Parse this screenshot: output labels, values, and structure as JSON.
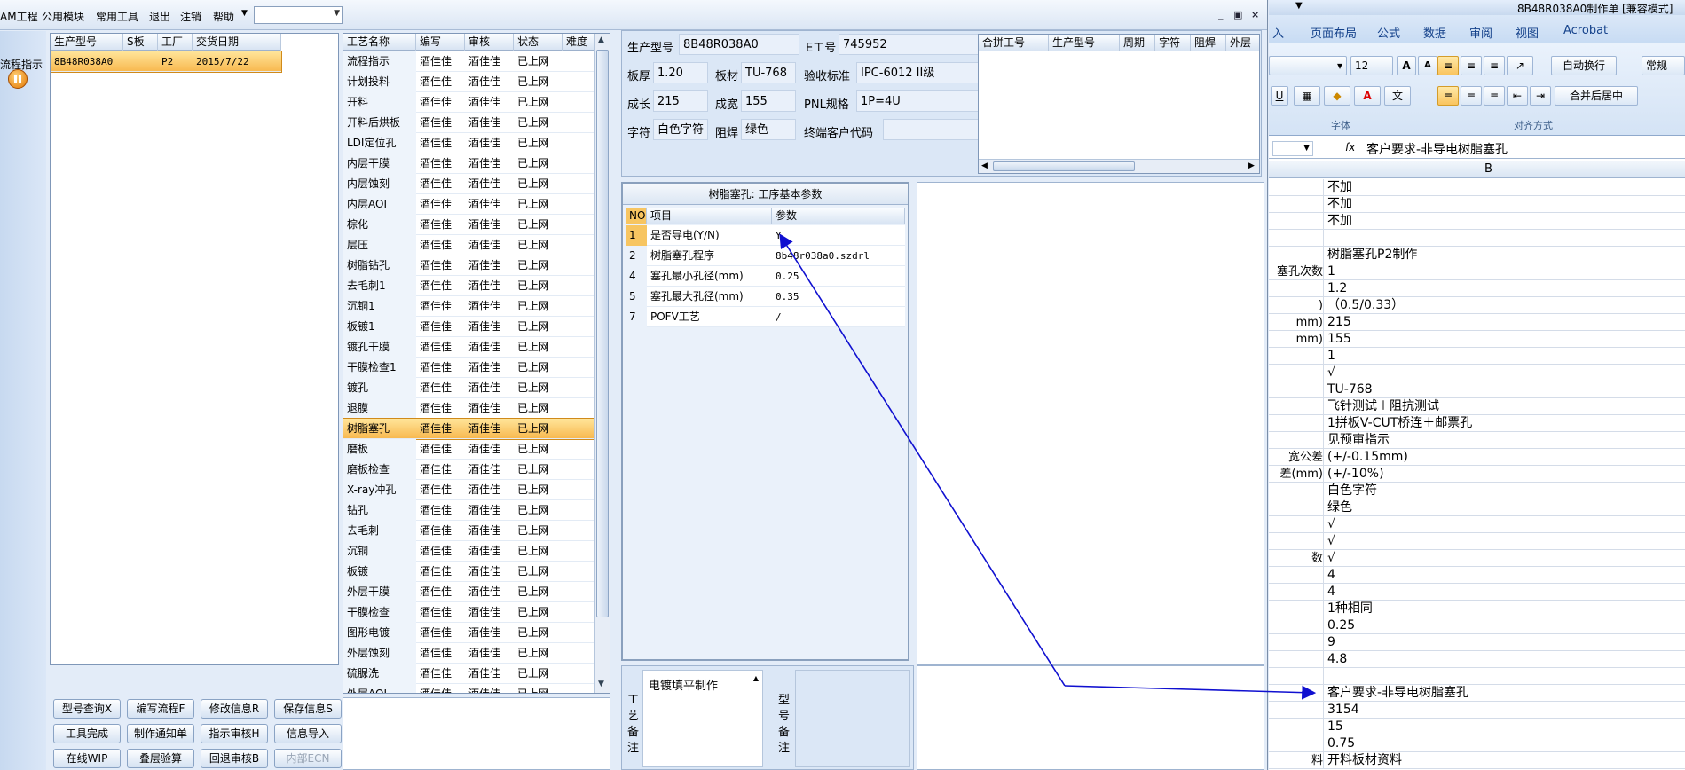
{
  "menu": {
    "items": [
      "AM工程",
      "公用模块",
      "常用工具",
      "退出",
      "注销",
      "帮助"
    ],
    "window_controls": [
      "_",
      "▣",
      "×"
    ]
  },
  "left_nav": {
    "label": "流程指示"
  },
  "model_grid": {
    "headers": [
      "生产型号",
      "S板",
      "工厂",
      "交货日期"
    ],
    "rows": [
      [
        "8B48R038A0",
        "",
        "P2",
        "2015/7/22"
      ]
    ]
  },
  "process_grid": {
    "headers": [
      "工艺名称",
      "编写",
      "审核",
      "状态",
      "难度"
    ],
    "rows": [
      [
        "流程指示",
        "酒佳佳",
        "酒佳佳",
        "已上网"
      ],
      [
        "计划投料",
        "酒佳佳",
        "酒佳佳",
        "已上网"
      ],
      [
        "开料",
        "酒佳佳",
        "酒佳佳",
        "已上网"
      ],
      [
        "开料后烘板",
        "酒佳佳",
        "酒佳佳",
        "已上网"
      ],
      [
        "LDI定位孔",
        "酒佳佳",
        "酒佳佳",
        "已上网"
      ],
      [
        "内层干膜",
        "酒佳佳",
        "酒佳佳",
        "已上网"
      ],
      [
        "内层蚀刻",
        "酒佳佳",
        "酒佳佳",
        "已上网"
      ],
      [
        "内层AOI",
        "酒佳佳",
        "酒佳佳",
        "已上网"
      ],
      [
        "棕化",
        "酒佳佳",
        "酒佳佳",
        "已上网"
      ],
      [
        "层压",
        "酒佳佳",
        "酒佳佳",
        "已上网"
      ],
      [
        "树脂钻孔",
        "酒佳佳",
        "酒佳佳",
        "已上网"
      ],
      [
        "去毛刺1",
        "酒佳佳",
        "酒佳佳",
        "已上网"
      ],
      [
        "沉铜1",
        "酒佳佳",
        "酒佳佳",
        "已上网"
      ],
      [
        "板镀1",
        "酒佳佳",
        "酒佳佳",
        "已上网"
      ],
      [
        "镀孔干膜",
        "酒佳佳",
        "酒佳佳",
        "已上网"
      ],
      [
        "干膜检查1",
        "酒佳佳",
        "酒佳佳",
        "已上网"
      ],
      [
        "镀孔",
        "酒佳佳",
        "酒佳佳",
        "已上网"
      ],
      [
        "退膜",
        "酒佳佳",
        "酒佳佳",
        "已上网"
      ],
      [
        "树脂塞孔",
        "酒佳佳",
        "酒佳佳",
        "已上网"
      ],
      [
        "磨板",
        "酒佳佳",
        "酒佳佳",
        "已上网"
      ],
      [
        "磨板检查",
        "酒佳佳",
        "酒佳佳",
        "已上网"
      ],
      [
        "X-ray冲孔",
        "酒佳佳",
        "酒佳佳",
        "已上网"
      ],
      [
        "钻孔",
        "酒佳佳",
        "酒佳佳",
        "已上网"
      ],
      [
        "去毛刺",
        "酒佳佳",
        "酒佳佳",
        "已上网"
      ],
      [
        "沉铜",
        "酒佳佳",
        "酒佳佳",
        "已上网"
      ],
      [
        "板镀",
        "酒佳佳",
        "酒佳佳",
        "已上网"
      ],
      [
        "外层干膜",
        "酒佳佳",
        "酒佳佳",
        "已上网"
      ],
      [
        "干膜检查",
        "酒佳佳",
        "酒佳佳",
        "已上网"
      ],
      [
        "图形电镀",
        "酒佳佳",
        "酒佳佳",
        "已上网"
      ],
      [
        "外层蚀刻",
        "酒佳佳",
        "酒佳佳",
        "已上网"
      ],
      [
        "硫脲洗",
        "酒佳佳",
        "酒佳佳",
        "已上网"
      ],
      [
        "外层AOI",
        "酒佳佳",
        "酒佳佳",
        "已上网"
      ]
    ],
    "selected_index": 18
  },
  "buttons": [
    [
      "型号查询X",
      "编写流程F",
      "修改信息R",
      "保存信息S"
    ],
    [
      "工具完成",
      "制作通知单",
      "指示审核H",
      "信息导入"
    ],
    [
      "在线WIP",
      "叠层验算",
      "回退审核B",
      "内部ECN"
    ]
  ],
  "info": {
    "model_label": "生产型号",
    "model": "8B48R038A0",
    "e_label": "E工号",
    "e_no": "745952",
    "thick_label": "板厚",
    "thick": "1.20",
    "material_label": "板材",
    "material": "TU-768",
    "std_label": "验收标准",
    "std": "IPC-6012 II级",
    "len_label": "成长",
    "len": "215",
    "wid_label": "成宽",
    "wid": "155",
    "pnl_label": "PNL规格",
    "pnl": "1P=4U",
    "char_label": "字符",
    "char": "白色字符",
    "mask_label": "阻焊",
    "mask": "绿色",
    "cust_label": "终端客户代码",
    "cust": ""
  },
  "merge_grid": {
    "headers": [
      "合拼工号",
      "生产型号",
      "周期",
      "字符",
      "阻焊",
      "外层"
    ]
  },
  "params": {
    "title": "树脂塞孔: 工序基本参数",
    "headers": [
      "NO",
      "项目",
      "参数"
    ],
    "rows": [
      [
        "1",
        "是否导电(Y/N)",
        "Y"
      ],
      [
        "2",
        "树脂塞孔程序",
        "8b48r038a0.szdrl"
      ],
      [
        "4",
        "塞孔最小孔径(mm)",
        "0.25"
      ],
      [
        "5",
        "塞孔最大孔径(mm)",
        "0.35"
      ],
      [
        "7",
        "POFV工艺",
        "/"
      ]
    ]
  },
  "remark": {
    "label_left": "工艺备注",
    "text": "电镀填平制作",
    "label_right": "型号备注"
  },
  "excel": {
    "title": "8B48R038A0制作单 [兼容模式]",
    "tabs": [
      "入",
      "页面布局",
      "公式",
      "数据",
      "审阅",
      "视图",
      "Acrobat"
    ],
    "font_size": "12",
    "wrap_label": "自动换行",
    "normal_label": "常规",
    "merge_label": "合并后居中",
    "group_font": "字体",
    "group_align": "对齐方式",
    "formula": "客户要求-非导电树脂塞孔",
    "fx": "fx",
    "column_b": "B",
    "rows": [
      [
        "",
        "不加"
      ],
      [
        "",
        "不加"
      ],
      [
        "",
        "不加"
      ],
      [
        "",
        ""
      ],
      [
        "",
        "树脂塞孔P2制作"
      ],
      [
        "塞孔次数",
        "1"
      ],
      [
        "",
        "1.2"
      ],
      [
        ")",
        "（0.5/0.33）"
      ],
      [
        "mm)",
        "215"
      ],
      [
        "mm)",
        "155"
      ],
      [
        "",
        "1"
      ],
      [
        "",
        "√"
      ],
      [
        "",
        "TU-768"
      ],
      [
        "",
        "飞针测试＋阻抗测试"
      ],
      [
        "",
        "1拼板V-CUT桥连＋邮票孔"
      ],
      [
        "",
        "见预审指示"
      ],
      [
        "宽公差",
        "(+/-0.15mm)"
      ],
      [
        "差(mm)",
        "(+/-10%)"
      ],
      [
        "",
        "白色字符"
      ],
      [
        "",
        "绿色"
      ],
      [
        "",
        "√"
      ],
      [
        "",
        "√"
      ],
      [
        "数",
        "√"
      ],
      [
        "",
        "4"
      ],
      [
        "",
        "4"
      ],
      [
        "",
        "1种相同"
      ],
      [
        "",
        "0.25"
      ],
      [
        "",
        "9"
      ],
      [
        "",
        "4.8"
      ],
      [
        "",
        ""
      ],
      [
        "",
        "客户要求-非导电树脂塞孔"
      ],
      [
        "",
        "3154"
      ],
      [
        "",
        "15"
      ],
      [
        "",
        "0.75"
      ],
      [
        "料",
        "开料板材资料"
      ]
    ]
  },
  "colors": {
    "arrow": "#1010d0",
    "selection": "#f8b950",
    "header": "#d8e4f3"
  }
}
